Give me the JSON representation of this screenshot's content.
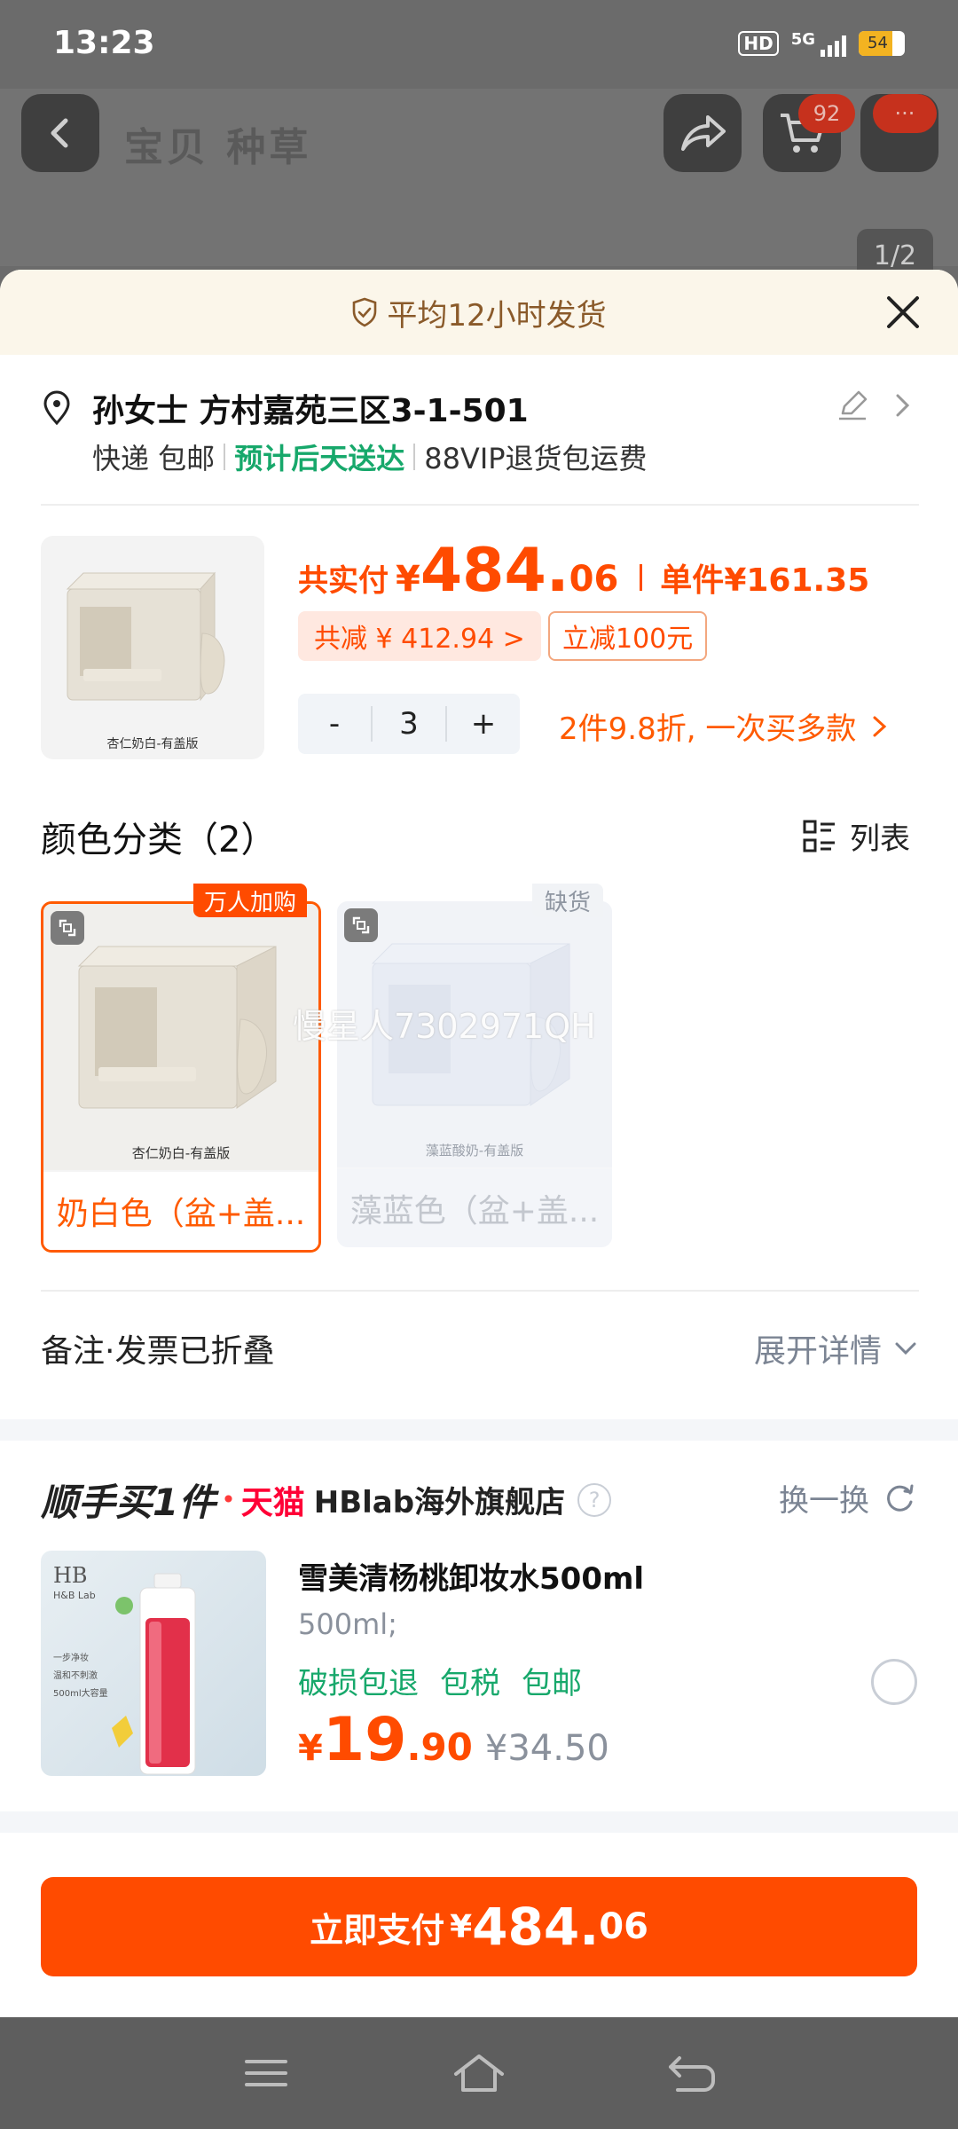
{
  "status_bar": {
    "time": "13:23",
    "hd": "HD",
    "network": "5G",
    "battery": "54"
  },
  "background": {
    "tabs_text": "宝贝  种草",
    "cart_badge": "92",
    "more_badge": "···",
    "pager": "1/2"
  },
  "sheet": {
    "shipping_banner": "平均12小时发货",
    "address": {
      "name": "孙女士 方村嘉苑三区3-1-501",
      "express": "快递 包邮",
      "eta": "预计后天送达",
      "returns": "88VIP退货包运费"
    },
    "price": {
      "label": "共实付",
      "yen": "¥",
      "main": "484.",
      "decimal": "06",
      "unit_label": "单件",
      "unit_price": "¥161.35",
      "discount_tag": "共减 ¥ 412.94 >",
      "coupon_tag": "立减100元"
    },
    "quantity": {
      "minus": "-",
      "value": "3",
      "plus": "+"
    },
    "promo": "2件9.8折, 一次买多款",
    "thumb_caption": "杏仁奶白-有盖版",
    "variants": {
      "title": "颜色分类（2）",
      "list_label": "列表",
      "items": [
        {
          "name": "奶白色（盆+盖...",
          "caption": "杏仁奶白-有盖版",
          "tag": "万人加购"
        },
        {
          "name": "藻蓝色（盆+盖...",
          "caption": "藻蓝酸奶-有盖版",
          "tag": "缺货"
        }
      ],
      "watermark": "慢星人7302971QH"
    },
    "notes": {
      "left": "备注·发票已折叠",
      "right": "展开详情"
    },
    "recommend": {
      "title": "顺手买1件",
      "tmall": "天猫",
      "store": "HBlab海外旗舰店",
      "swap": "换一换",
      "product_name": "雪美清杨桃卸妆水500ml",
      "spec": "500ml;",
      "tags": [
        "破损包退",
        "包税",
        "包邮"
      ],
      "price_yen": "¥",
      "price_main": "19",
      "price_decimal": ".90",
      "original_price": "¥34.50",
      "thumb_brand": "HB",
      "thumb_sub": "H&B Lab",
      "thumb_lines": [
        "一步净妆",
        "温和不刺激",
        "500ml大容量"
      ]
    },
    "pay_button": {
      "label": "立即支付",
      "yen": "¥",
      "main": "484.",
      "decimal": "06"
    }
  },
  "colors": {
    "accent": "#ff4b00",
    "green": "#17a86b",
    "banner_bg": "#fbf6ea"
  }
}
